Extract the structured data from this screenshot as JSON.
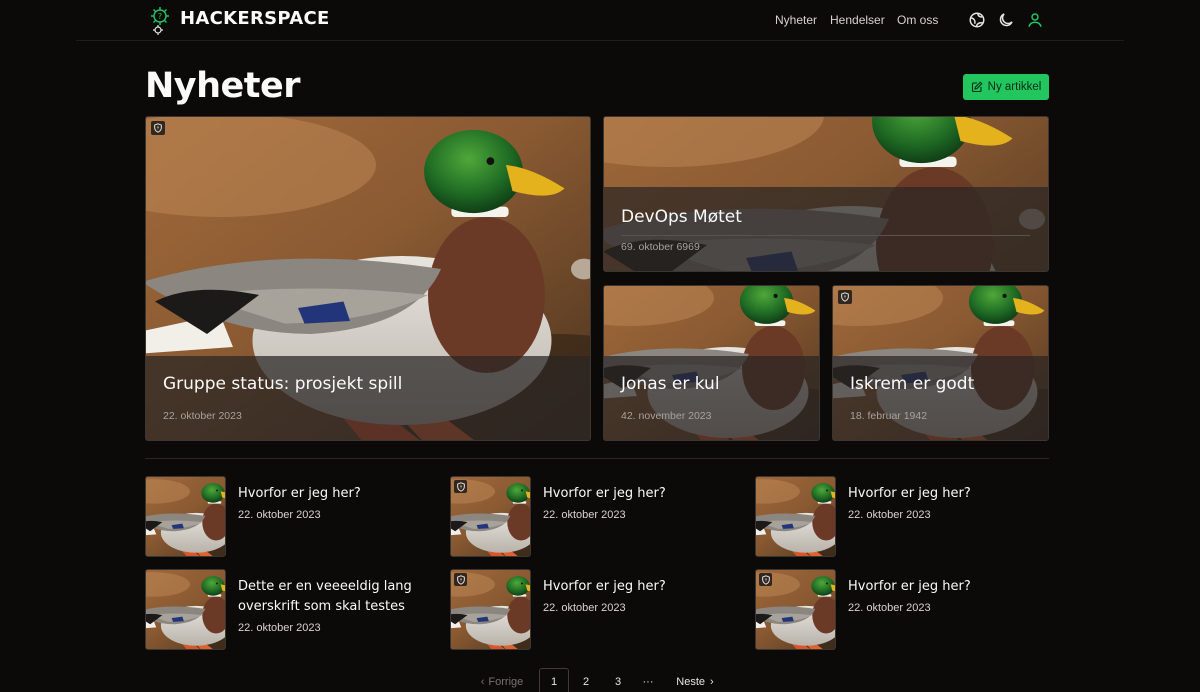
{
  "header": {
    "brand": "HACKERSPACE",
    "nav": [
      "Nyheter",
      "Hendelser",
      "Om oss"
    ],
    "icons": [
      "globe-icon",
      "moon-icon",
      "user-icon"
    ],
    "accent": "#22c55e"
  },
  "page": {
    "title": "Nyheter",
    "new_article_label": "Ny artikkel"
  },
  "featured": [
    {
      "title": "Gruppe status: prosjekt spill",
      "date": "22. oktober 2023",
      "restricted": true
    },
    {
      "title": "DevOps Møtet",
      "date": "69. oktober 6969",
      "restricted": false
    },
    {
      "title": "Jonas er kul",
      "date": "42. november 2023",
      "restricted": false
    },
    {
      "title": "Iskrem er godt",
      "date": "18. februar 1942",
      "restricted": true
    }
  ],
  "articles": [
    {
      "title": "Hvorfor er jeg her?",
      "date": "22. oktober 2023",
      "restricted": false
    },
    {
      "title": "Hvorfor er jeg her?",
      "date": "22. oktober 2023",
      "restricted": true
    },
    {
      "title": "Hvorfor er jeg her?",
      "date": "22. oktober 2023",
      "restricted": false
    },
    {
      "title": "Dette er en veeeeldig lang overskrift som skal testes",
      "date": "22. oktober 2023",
      "restricted": false
    },
    {
      "title": "Hvorfor er jeg her?",
      "date": "22. oktober 2023",
      "restricted": true
    },
    {
      "title": "Hvorfor er jeg her?",
      "date": "22. oktober 2023",
      "restricted": true
    }
  ],
  "pagination": {
    "prev_label": "Forrige",
    "pages": [
      "1",
      "2",
      "3"
    ],
    "ellipsis": "···",
    "next_label": "Neste",
    "current": "1"
  }
}
